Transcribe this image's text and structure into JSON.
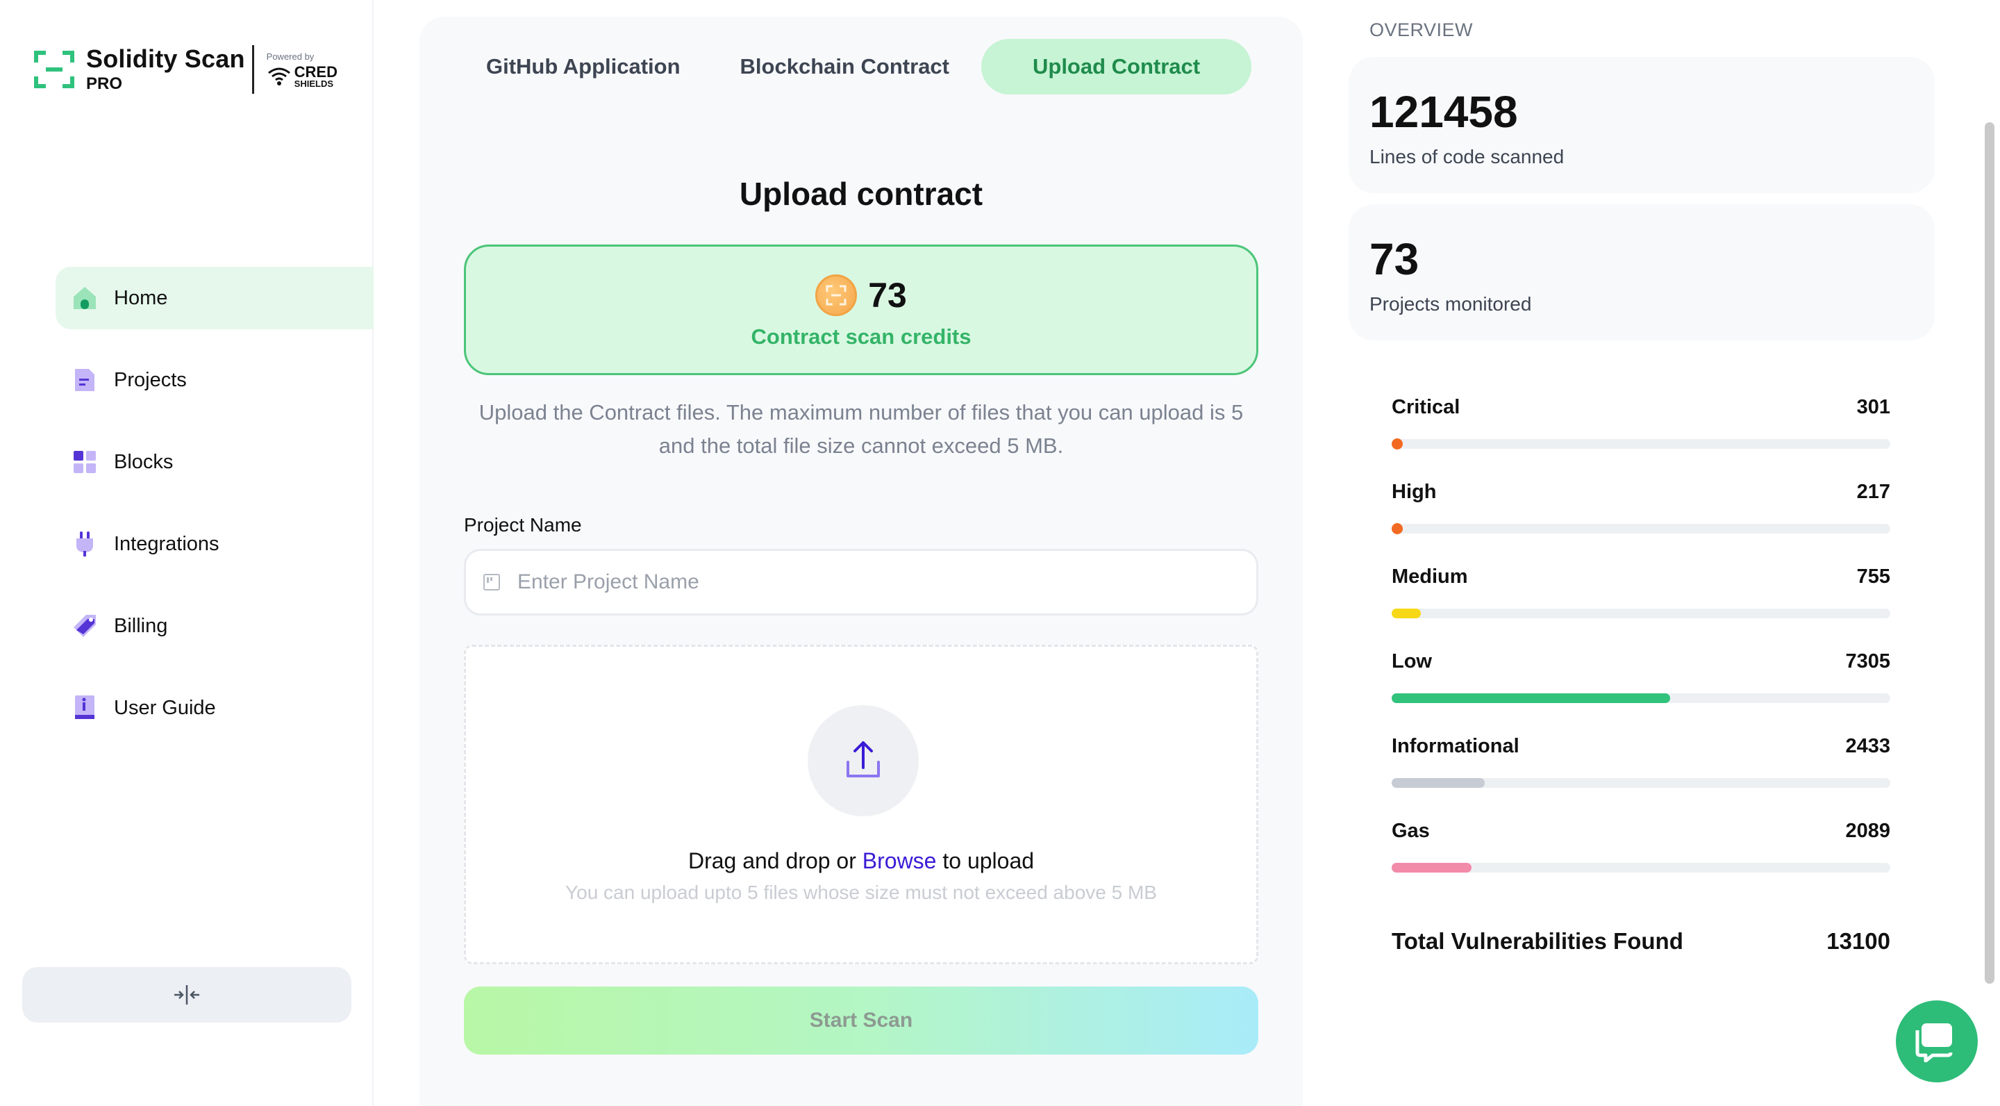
{
  "brand": {
    "title": "Solidity Scan",
    "sub": "PRO",
    "powered_by": "Powered by",
    "partner_top": "CRED",
    "partner_bottom": "SHIELDS"
  },
  "sidebar": {
    "items": [
      {
        "label": "Home",
        "icon": "home-icon",
        "active": true
      },
      {
        "label": "Projects",
        "icon": "file-icon"
      },
      {
        "label": "Blocks",
        "icon": "blocks-icon"
      },
      {
        "label": "Integrations",
        "icon": "plug-icon"
      },
      {
        "label": "Billing",
        "icon": "tag-icon"
      },
      {
        "label": "User Guide",
        "icon": "book-icon"
      }
    ],
    "collapse_icon": "collapse-icon"
  },
  "tabs": [
    {
      "label": "GitHub Application"
    },
    {
      "label": "Blockchain Contract"
    },
    {
      "label": "Upload Contract",
      "active": true
    }
  ],
  "upload": {
    "title": "Upload contract",
    "credits_count": "73",
    "credits_label": "Contract scan credits",
    "info": "Upload the Contract files. The maximum number of files that you can upload is 5 and the total file size cannot exceed 5 MB.",
    "project_label": "Project Name",
    "project_placeholder": "Enter Project Name",
    "project_value": "",
    "drag_prefix": "Drag and drop or ",
    "browse": "Browse",
    "drag_suffix": " to upload",
    "hint": "You can upload upto 5 files whose size must not exceed above 5 MB",
    "start_label": "Start Scan"
  },
  "overview": {
    "label": "OVERVIEW",
    "lines_value": "121458",
    "lines_label": "Lines of code scanned",
    "projects_value": "73",
    "projects_label": "Projects monitored",
    "vulnerabilities": [
      {
        "name": "Critical",
        "count": "301",
        "fraction": 0.023,
        "color": "#f26a21"
      },
      {
        "name": "High",
        "count": "217",
        "fraction": 0.017,
        "color": "#f26a21"
      },
      {
        "name": "Medium",
        "count": "755",
        "fraction": 0.058,
        "color": "#f7d816"
      },
      {
        "name": "Low",
        "count": "7305",
        "fraction": 0.558,
        "color": "#31c27c"
      },
      {
        "name": "Informational",
        "count": "2433",
        "fraction": 0.186,
        "color": "#c6cbd4"
      },
      {
        "name": "Gas",
        "count": "2089",
        "fraction": 0.16,
        "color": "#f28aa9"
      }
    ],
    "total_label": "Total Vulnerabilities Found",
    "total_value": "13100"
  },
  "colors": {
    "accent": "#2ebc79",
    "active_tab_bg": "#c6f4d4",
    "browse_link": "#3a1bd6"
  }
}
